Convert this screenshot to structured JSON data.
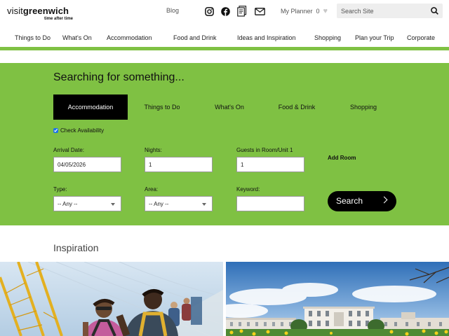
{
  "header": {
    "logo_prefix": "visit",
    "logo_name": "greenwich",
    "logo_tagline": "time after time",
    "blog_label": "Blog",
    "social_icons": [
      "instagram-icon",
      "facebook-icon",
      "brochure-icon",
      "mail-icon"
    ],
    "planner_label": "My Planner",
    "planner_count": "0",
    "search_placeholder": "Search Site"
  },
  "nav": {
    "items": [
      "Things to Do",
      "What's On",
      "Accommodation",
      "Food and Drink",
      "Ideas and Inspiration",
      "Shopping",
      "Plan your Trip",
      "Corporate"
    ]
  },
  "search_panel": {
    "title": "Searching for something...",
    "tabs": [
      "Accommodation",
      "Things to Do",
      "What's On",
      "Food & Drink",
      "Shopping"
    ],
    "active_tab": "Accommodation",
    "check_availability_label": "Check Availability",
    "check_availability_checked": true,
    "arrival_label": "Arrival Date:",
    "arrival_value": "04/05/2026",
    "nights_label": "Nights:",
    "nights_value": "1",
    "guests_label": "Guests in Room/Unit 1",
    "guests_value": "1",
    "add_room_label": "Add Room",
    "type_label": "Type:",
    "type_value": "-- Any --",
    "area_label": "Area:",
    "area_value": "-- Any --",
    "keyword_label": "Keyword:",
    "keyword_value": "",
    "search_button_label": "Search"
  },
  "inspiration": {
    "title": "Inspiration"
  },
  "colors": {
    "brand_green": "#7fc143",
    "active_tab_bg": "#000000",
    "button_bg": "#000000"
  }
}
